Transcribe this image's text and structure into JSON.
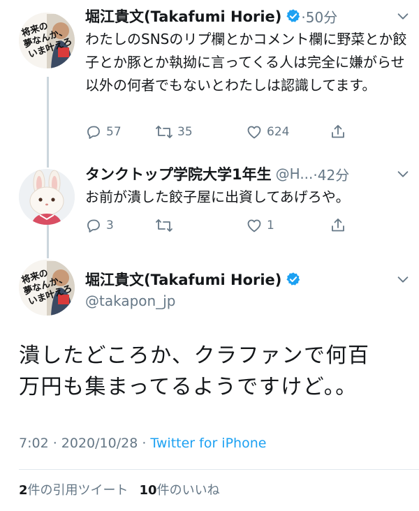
{
  "tweets": [
    {
      "name": "堀江貴文(Takafumi Horie)",
      "verified": true,
      "handle": "",
      "time": "·50分",
      "text": "わたしのSNSのリプ欄とかコメント欄に野菜とか餃子とか豚とか執拗に言ってくる人は完全に嫌がらせ以外の何者でもないとわたしは認識してます。",
      "replies": "57",
      "retweets": "35",
      "likes": "624",
      "avatar": {
        "book_title": "将来の夢なんか、いま叶えろ。",
        "book_small_text": "堀江貴文"
      }
    },
    {
      "name": "タンクトップ学院大学1年生",
      "handle": "@H...",
      "time": "·42分",
      "text": "お前が潰した餃子屋に出資してあげろや。",
      "replies": "3",
      "retweets": "",
      "likes": "1",
      "avatar": {
        "subject": "white rabbit figure"
      }
    }
  ],
  "main_tweet": {
    "name": "堀江貴文(Takafumi Horie)",
    "verified": true,
    "handle": "@takapon_jp",
    "text_line1": "潰したどころか、クラファンで何百",
    "text_line2": "万円も集まってるようですけど。。",
    "timestamp": "7:02 · 2020/10/28 · ",
    "source": "Twitter for iPhone",
    "quote_count": "2",
    "quote_label": "件の引用ツイート",
    "like_count": "10",
    "like_label": "件のいいね"
  },
  "icons": {
    "verified": "verified-badge-icon",
    "caret": "chevron-down-icon",
    "reply": "reply-icon",
    "retweet": "retweet-icon",
    "like": "heart-icon",
    "share": "share-icon"
  },
  "colors": {
    "accent": "#1da1f2",
    "muted": "#657786",
    "text": "#14171a",
    "thread_line": "#ccd6dd"
  }
}
